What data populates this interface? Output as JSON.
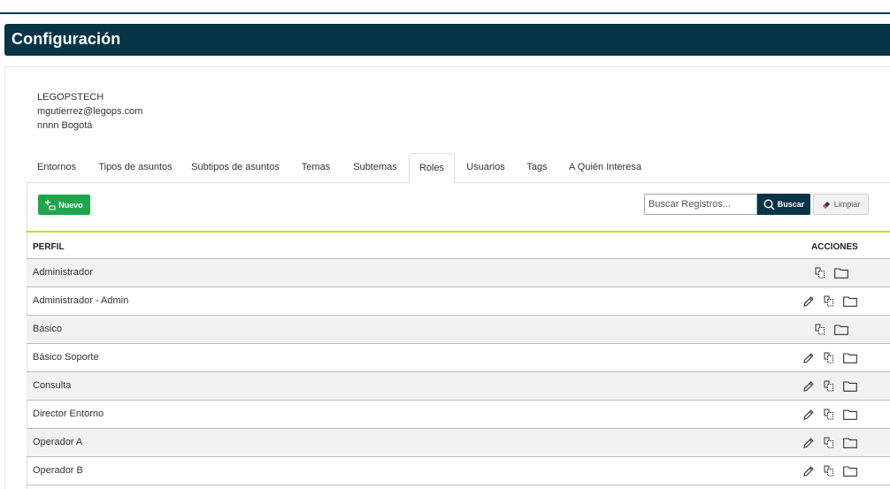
{
  "header": {
    "title": "Configuración"
  },
  "org": {
    "name": "LEGOPSTECH",
    "email": "mgutierrez@legops.com",
    "location": "nnnn Bogotá"
  },
  "tabs": [
    {
      "label": "Entornos"
    },
    {
      "label": "Tipos de asuntos"
    },
    {
      "label": "Subtipos de asuntos"
    },
    {
      "label": "Temas"
    },
    {
      "label": "Subtemas"
    },
    {
      "label": "Roles"
    },
    {
      "label": "Usuarios"
    },
    {
      "label": "Tags"
    },
    {
      "label": "A Quién Interesa"
    }
  ],
  "active_tab": "Roles",
  "toolbar": {
    "new_label": "Nuevo",
    "search_placeholder": "Buscar Registros...",
    "search_label": "Buscar",
    "clear_label": "Limpiar"
  },
  "table": {
    "columns": [
      "PERFIL",
      "ACCIONES"
    ],
    "rows": [
      {
        "perfil": "Administrador",
        "actions": [
          "copy",
          "folder"
        ]
      },
      {
        "perfil": "Administrador - Admin",
        "actions": [
          "edit",
          "copy",
          "folder"
        ]
      },
      {
        "perfil": "Básico",
        "actions": [
          "copy",
          "folder"
        ]
      },
      {
        "perfil": "Básico Soporte",
        "actions": [
          "edit",
          "copy",
          "folder"
        ]
      },
      {
        "perfil": "Consulta",
        "actions": [
          "edit",
          "copy",
          "folder"
        ]
      },
      {
        "perfil": "Director Entorno",
        "actions": [
          "edit",
          "copy",
          "folder"
        ]
      },
      {
        "perfil": "Operador A",
        "actions": [
          "edit",
          "copy",
          "folder"
        ]
      },
      {
        "perfil": "Operador B",
        "actions": [
          "edit",
          "copy",
          "folder"
        ]
      }
    ]
  },
  "colors": {
    "header_bg": "#083447",
    "new_button": "#1ea64f",
    "table_accent": "#c5d92d"
  }
}
